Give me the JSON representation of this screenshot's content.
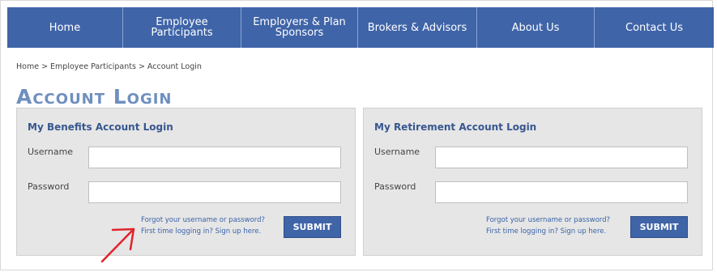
{
  "nav": {
    "items": [
      {
        "label": "Home"
      },
      {
        "label": "Employee Participants"
      },
      {
        "label": "Employers & Plan Sponsors"
      },
      {
        "label": "Brokers & Advisors"
      },
      {
        "label": "About Us"
      },
      {
        "label": "Contact Us"
      }
    ]
  },
  "breadcrumb": "Home > Employee Participants > Account Login",
  "page_title": "Account Login",
  "benefits": {
    "title": "My Benefits Account Login",
    "username_label": "Username",
    "password_label": "Password",
    "username_value": "",
    "password_value": "",
    "forgot_link": "Forgot your username or password?",
    "signup_link": "First time logging in? Sign up here.",
    "submit_label": "SUBMIT"
  },
  "retirement": {
    "title": "My Retirement Account Login",
    "username_label": "Username",
    "password_label": "Password",
    "username_value": "",
    "password_value": "",
    "forgot_link": "Forgot your username or password?",
    "signup_link": "First time logging in? Sign up here.",
    "submit_label": "SUBMIT"
  },
  "colors": {
    "nav_bg": "#3f64a8",
    "title_color": "#6e8fbf",
    "link_color": "#3a63a8",
    "annotation_arrow": "#e0242c"
  },
  "icons": {
    "annotation": "red-arrow-icon"
  }
}
